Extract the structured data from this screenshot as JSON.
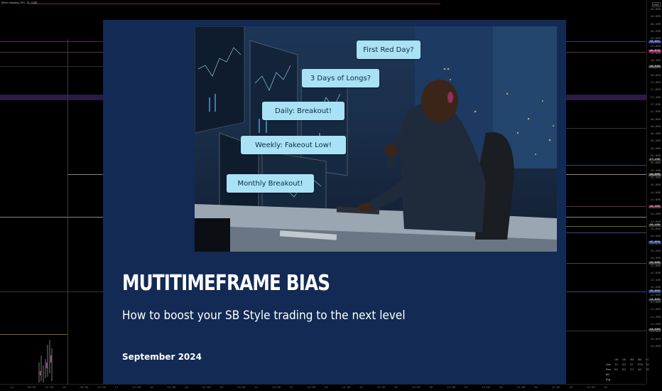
{
  "chart": {
    "symbol_title": "Micro Nasdaq-100, 15, CME",
    "currency": "USD",
    "price_ticks": [
      "19,800",
      "19,600",
      "19,400",
      "19,200",
      "19,000",
      "18,800",
      "18,600",
      "18,400",
      "18,200",
      "18,000",
      "17,800",
      "17,600",
      "17,400",
      "17,200",
      "17,000",
      "16,800",
      "16,600",
      "16,400",
      "16,200",
      "16,000",
      "15,800",
      "15,600",
      "15,400",
      "15,200",
      "15,000",
      "14,800",
      "14,600",
      "14,400",
      "14,200",
      "14,000",
      "13,800",
      "13,600",
      "13,400",
      "13,200",
      "13,000",
      "12,800",
      "12,600",
      "12,400",
      "12,200",
      "12,000",
      "11,800",
      "11,600",
      "11,400",
      "11,200",
      "11,000",
      "10,800",
      "10,600"
    ],
    "time_ticks": [
      "13",
      "00:00",
      "12:00",
      "16",
      "00:00",
      "12:00",
      "17",
      "12:00",
      "18",
      "12:00",
      "19",
      "12:00",
      "20",
      "12:00",
      "21",
      "12:00",
      "22",
      "12:00",
      "23",
      "12:00",
      "24",
      "12:00",
      "25",
      "12:00",
      "26",
      "12:00",
      "27",
      "12:00",
      "28",
      "12:00",
      "29",
      "12:00",
      "30",
      "12:00",
      "31"
    ]
  },
  "stats_table": {
    "headers": [
      "1W",
      "1M",
      "3M",
      "6M",
      "1Y"
    ],
    "rows": [
      {
        "label": "Curr",
        "values": [
          "TO",
          "SO",
          "ST",
          "POV",
          "TO"
        ]
      },
      {
        "label": "Prev",
        "values": [
          "SO",
          "SO",
          "TO",
          "SO",
          "TO"
        ]
      },
      {
        "label": "BO",
        "values": [
          "",
          "",
          "",
          "",
          ""
        ]
      },
      {
        "label": "Eng",
        "values": [
          "",
          "",
          "",
          "",
          ""
        ]
      }
    ]
  },
  "slide": {
    "bubbles": {
      "first_red_day": "First Red Day?",
      "three_days_longs": "3 Days of Longs?",
      "daily_breakout": "Daily:  Breakout!",
      "weekly_fakeout": "Weekly: Fakeout Low!",
      "monthly_breakout": "Monthly Breakout!"
    },
    "title": "MUTITIMEFRAME BIAS",
    "subtitle": "How to boost your SB Style trading to the next level",
    "date": "September 2024"
  },
  "colors": {
    "slide_bg": "#122a54",
    "bubble_bg": "#a8e2f4",
    "title_text": "#ffffff"
  }
}
